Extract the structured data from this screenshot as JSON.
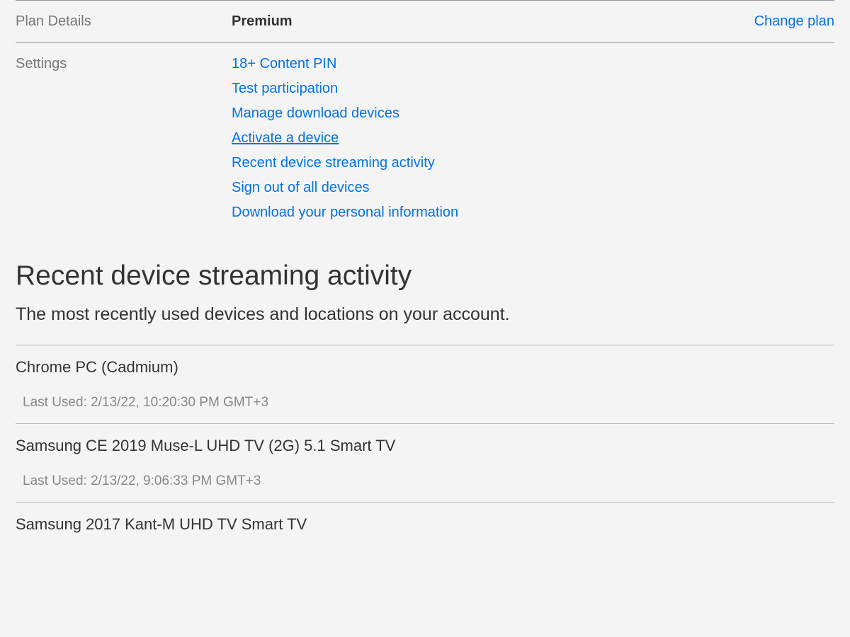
{
  "plan": {
    "label": "Plan Details",
    "name": "Premium",
    "change_link": "Change plan"
  },
  "settings": {
    "label": "Settings",
    "links": [
      "18+ Content PIN",
      "Test participation",
      "Manage download devices",
      "Activate a device",
      "Recent device streaming activity",
      "Sign out of all devices",
      "Download your personal information"
    ]
  },
  "activity": {
    "heading": "Recent device streaming activity",
    "subheading": "The most recently used devices and locations on your account.",
    "devices": [
      {
        "name": "Chrome PC (Cadmium)",
        "last_used": "Last Used: 2/13/22, 10:20:30 PM GMT+3"
      },
      {
        "name": "Samsung CE 2019 Muse-L UHD TV (2G) 5.1 Smart TV",
        "last_used": "Last Used: 2/13/22, 9:06:33 PM GMT+3"
      },
      {
        "name": "Samsung 2017 Kant-M UHD TV Smart TV",
        "last_used": ""
      }
    ]
  }
}
